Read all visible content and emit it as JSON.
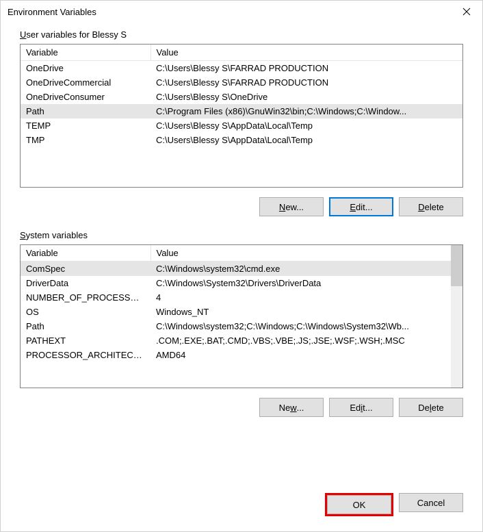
{
  "window": {
    "title": "Environment Variables"
  },
  "user_section": {
    "label_prefix": "U",
    "label_rest": "ser variables for Blessy S",
    "headers": {
      "var": "Variable",
      "val": "Value"
    },
    "rows": [
      {
        "var": "OneDrive",
        "val": "C:\\Users\\Blessy S\\FARRAD PRODUCTION",
        "selected": false
      },
      {
        "var": "OneDriveCommercial",
        "val": "C:\\Users\\Blessy S\\FARRAD PRODUCTION",
        "selected": false
      },
      {
        "var": "OneDriveConsumer",
        "val": "C:\\Users\\Blessy S\\OneDrive",
        "selected": false
      },
      {
        "var": "Path",
        "val": "C:\\Program Files (x86)\\GnuWin32\\bin;C:\\Windows;C:\\Window...",
        "selected": true
      },
      {
        "var": "TEMP",
        "val": "C:\\Users\\Blessy S\\AppData\\Local\\Temp",
        "selected": false
      },
      {
        "var": "TMP",
        "val": "C:\\Users\\Blessy S\\AppData\\Local\\Temp",
        "selected": false
      }
    ],
    "buttons": {
      "new_u": "N",
      "new_rest": "ew...",
      "edit_u": "E",
      "edit_rest": "dit...",
      "delete_u": "D",
      "delete_rest": "elete"
    }
  },
  "system_section": {
    "label_prefix": "S",
    "label_rest": "ystem variables",
    "headers": {
      "var": "Variable",
      "val": "Value"
    },
    "rows": [
      {
        "var": "ComSpec",
        "val": "C:\\Windows\\system32\\cmd.exe",
        "selected": true
      },
      {
        "var": "DriverData",
        "val": "C:\\Windows\\System32\\Drivers\\DriverData",
        "selected": false
      },
      {
        "var": "NUMBER_OF_PROCESSORS",
        "val": "4",
        "selected": false
      },
      {
        "var": "OS",
        "val": "Windows_NT",
        "selected": false
      },
      {
        "var": "Path",
        "val": "C:\\Windows\\system32;C:\\Windows;C:\\Windows\\System32\\Wb...",
        "selected": false
      },
      {
        "var": "PATHEXT",
        "val": ".COM;.EXE;.BAT;.CMD;.VBS;.VBE;.JS;.JSE;.WSF;.WSH;.MSC",
        "selected": false
      },
      {
        "var": "PROCESSOR_ARCHITECTU...",
        "val": "AMD64",
        "selected": false
      }
    ],
    "buttons": {
      "new_u": "w",
      "new_pre": "Ne",
      "new_rest": "...",
      "edit_u": "i",
      "edit_pre": "Ed",
      "edit_rest": "t...",
      "delete_u": "l",
      "delete_pre": "De",
      "delete_rest": "ete"
    }
  },
  "footer": {
    "ok": "OK",
    "cancel": "Cancel"
  }
}
